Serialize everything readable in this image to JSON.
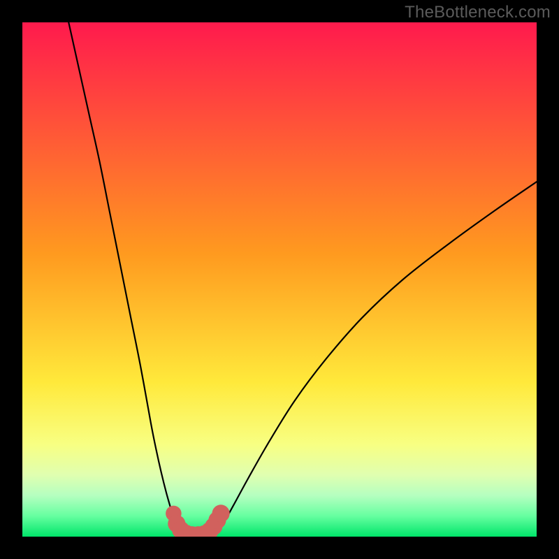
{
  "watermark": "TheBottleneck.com",
  "chart_data": {
    "type": "line",
    "title": "",
    "xlabel": "",
    "ylabel": "",
    "xlim": [
      0,
      100
    ],
    "ylim": [
      0,
      100
    ],
    "background_gradient": {
      "stops": [
        {
          "offset": 0.0,
          "color": "#ff1a4d"
        },
        {
          "offset": 0.45,
          "color": "#ff9a1f"
        },
        {
          "offset": 0.7,
          "color": "#ffe93b"
        },
        {
          "offset": 0.82,
          "color": "#f8ff82"
        },
        {
          "offset": 0.88,
          "color": "#e0ffb0"
        },
        {
          "offset": 0.92,
          "color": "#b5ffc0"
        },
        {
          "offset": 0.96,
          "color": "#66ffa0"
        },
        {
          "offset": 1.0,
          "color": "#00e56a"
        }
      ]
    },
    "series": [
      {
        "name": "left-curve",
        "x": [
          9.0,
          11.0,
          13.0,
          15.0,
          17.0,
          19.0,
          21.0,
          23.0,
          25.0,
          26.0,
          27.0,
          28.0,
          29.0,
          29.7,
          30.5
        ],
        "y": [
          100.0,
          91.0,
          82.0,
          73.0,
          63.0,
          53.0,
          43.0,
          33.0,
          22.0,
          17.0,
          12.5,
          8.5,
          5.0,
          2.5,
          0.5
        ]
      },
      {
        "name": "valley-floor",
        "x": [
          30.5,
          32.0,
          34.0,
          36.0,
          37.5
        ],
        "y": [
          0.5,
          0.0,
          0.0,
          0.0,
          0.5
        ]
      },
      {
        "name": "right-curve",
        "x": [
          37.5,
          39.0,
          41.0,
          44.0,
          48.0,
          53.0,
          59.0,
          66.0,
          74.0,
          83.0,
          92.0,
          100.0
        ],
        "y": [
          0.5,
          2.5,
          6.0,
          11.5,
          18.5,
          26.5,
          34.5,
          42.5,
          50.0,
          57.0,
          63.5,
          69.0
        ]
      }
    ],
    "marker_series": {
      "name": "valley-markers",
      "color": "#d1615d",
      "points": [
        {
          "x": 29.4,
          "y": 4.5,
          "r": 1.1
        },
        {
          "x": 30.0,
          "y": 2.5,
          "r": 1.3
        },
        {
          "x": 30.8,
          "y": 1.3,
          "r": 1.3
        },
        {
          "x": 31.8,
          "y": 0.6,
          "r": 1.3
        },
        {
          "x": 33.0,
          "y": 0.3,
          "r": 1.3
        },
        {
          "x": 34.2,
          "y": 0.3,
          "r": 1.3
        },
        {
          "x": 35.4,
          "y": 0.5,
          "r": 1.3
        },
        {
          "x": 36.4,
          "y": 1.1,
          "r": 1.3
        },
        {
          "x": 37.2,
          "y": 2.0,
          "r": 1.3
        },
        {
          "x": 37.9,
          "y": 3.2,
          "r": 1.3
        },
        {
          "x": 38.6,
          "y": 4.5,
          "r": 1.3
        }
      ]
    }
  }
}
